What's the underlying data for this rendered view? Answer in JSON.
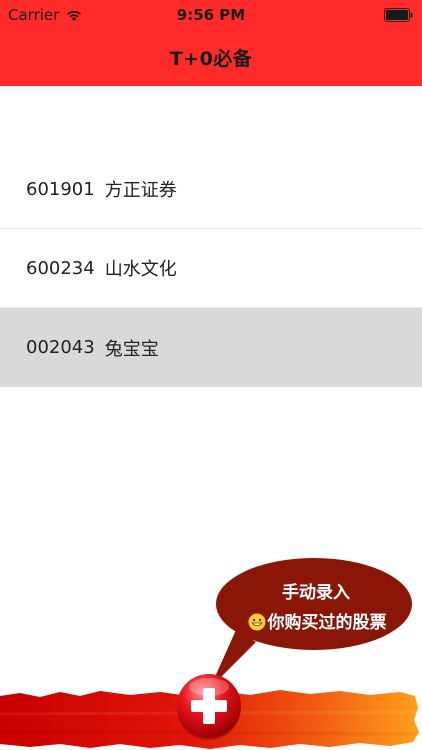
{
  "status_bar": {
    "carrier": "Carrier",
    "time": "9:56 PM",
    "wifi_icon": "wifi-icon",
    "battery_icon": "battery-icon"
  },
  "nav": {
    "title": "T+0必备"
  },
  "stocks": [
    {
      "code": "601901",
      "name": "方正证券",
      "selected": false
    },
    {
      "code": "600234",
      "name": "山水文化",
      "selected": false
    },
    {
      "code": "002043",
      "name": "兔宝宝",
      "selected": true
    }
  ],
  "tip": {
    "line1": "手动录入",
    "line2": "你购买过的股票",
    "emoji_icon": "grinning-face-icon"
  },
  "bottom_bar": {
    "add_icon": "plus-icon"
  },
  "colors": {
    "header_bg": "#ff2a2a",
    "selected_row_bg": "#d9d9d9",
    "bubble_bg": "#8a1608",
    "bottom_gradient_start": "#d40000",
    "bottom_gradient_end": "#ff9a1a"
  }
}
